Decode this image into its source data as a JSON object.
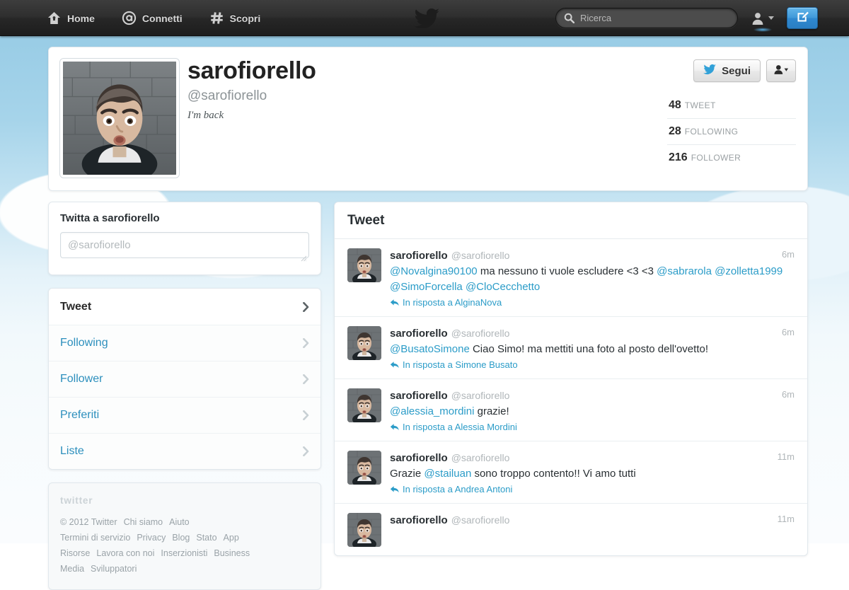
{
  "topnav": {
    "items": [
      {
        "label": "Home",
        "icon": "home-icon"
      },
      {
        "label": "Connetti",
        "icon": "at-icon"
      },
      {
        "label": "Scopri",
        "icon": "hash-icon"
      }
    ],
    "search_placeholder": "Ricerca",
    "search_value": "",
    "brand_icon": "twitter-bird-icon",
    "account_icon": "user-icon",
    "compose_icon": "compose-tweet-icon"
  },
  "profile": {
    "name": "sarofiorello",
    "handle": "@sarofiorello",
    "bio": "I'm back",
    "follow_label": "Segui",
    "follow_icon": "twitter-bird-icon",
    "more_icon": "user-actions-icon",
    "stats": [
      {
        "value": "48",
        "label": "TWEET"
      },
      {
        "value": "28",
        "label": "FOLLOWING"
      },
      {
        "value": "216",
        "label": "FOLLOWER"
      }
    ]
  },
  "compose": {
    "title": "Twitta a sarofiorello",
    "placeholder": "@sarofiorello",
    "value": ""
  },
  "sidebar_nav": [
    {
      "label": "Tweet",
      "active": true
    },
    {
      "label": "Following",
      "active": false
    },
    {
      "label": "Follower",
      "active": false
    },
    {
      "label": "Preferiti",
      "active": false
    },
    {
      "label": "Liste",
      "active": false
    }
  ],
  "footer": {
    "logo": "twitter-wordmark",
    "line1": [
      "© 2012 Twitter",
      "Chi siamo",
      "Aiuto"
    ],
    "line2": [
      "Termini di servizio",
      "Privacy",
      "Blog",
      "Stato",
      "App"
    ],
    "line3": [
      "Risorse",
      "Lavora con noi",
      "Inserzionisti",
      "Business"
    ],
    "line4": [
      "Media",
      "Sviluppatori"
    ]
  },
  "timeline": {
    "title": "Tweet",
    "tweets": [
      {
        "name": "sarofiorello",
        "handle": "@sarofiorello",
        "time": "6m",
        "parts": [
          {
            "t": "@Novalgina90100",
            "m": true
          },
          {
            "t": " ma nessuno ti vuole escludere <3 <3 ",
            "m": false
          },
          {
            "t": "@sabrarola",
            "m": true
          },
          {
            "t": " ",
            "m": false
          },
          {
            "t": "@zolletta1999",
            "m": true
          },
          {
            "t": " ",
            "m": false
          },
          {
            "t": "@SimoForcella",
            "m": true
          },
          {
            "t": " ",
            "m": false
          },
          {
            "t": "@CloCecchetto",
            "m": true
          }
        ],
        "reply": "In risposta a AlginaNova"
      },
      {
        "name": "sarofiorello",
        "handle": "@sarofiorello",
        "time": "6m",
        "parts": [
          {
            "t": "@BusatoSimone",
            "m": true
          },
          {
            "t": " Ciao Simo! ma mettiti una foto al posto dell'ovetto!",
            "m": false
          }
        ],
        "reply": "In risposta a Simone Busato"
      },
      {
        "name": "sarofiorello",
        "handle": "@sarofiorello",
        "time": "6m",
        "parts": [
          {
            "t": "@alessia_mordini",
            "m": true
          },
          {
            "t": " grazie!",
            "m": false
          }
        ],
        "reply": "In risposta a Alessia Mordini"
      },
      {
        "name": "sarofiorello",
        "handle": "@sarofiorello",
        "time": "11m",
        "parts": [
          {
            "t": "Grazie ",
            "m": false
          },
          {
            "t": "@stailuan",
            "m": true
          },
          {
            "t": " sono troppo contento!! Vi amo tutti",
            "m": false
          }
        ],
        "reply": "In risposta a Andrea Antoni"
      },
      {
        "name": "sarofiorello",
        "handle": "@sarofiorello",
        "time": "11m",
        "parts": [],
        "reply": ""
      }
    ]
  },
  "colors": {
    "link": "#2b9cc8",
    "accent": "#3e97d8",
    "text": "#292f33",
    "muted": "#b0b6b9"
  }
}
